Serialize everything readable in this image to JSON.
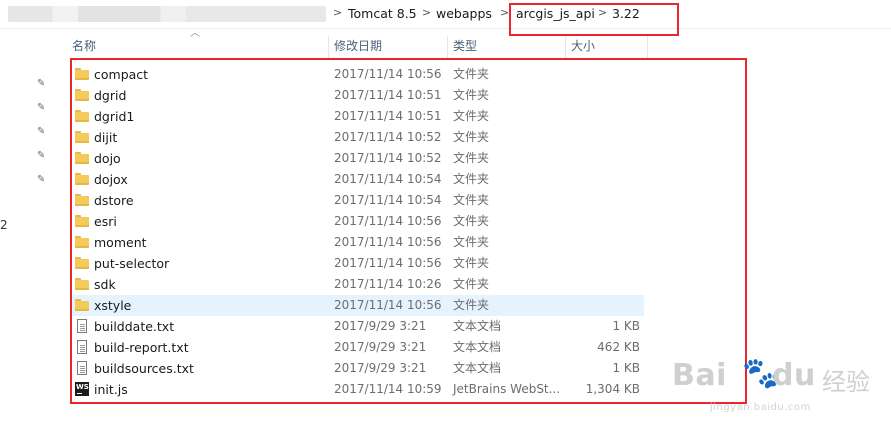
{
  "breadcrumb": {
    "items": [
      "Tomcat 8.5",
      "webapps",
      "arcgis_js_api",
      "3.22"
    ],
    "separator": ">"
  },
  "columns": {
    "name": "名称",
    "modified": "修改日期",
    "type": "类型",
    "size": "大小"
  },
  "side_number": "2",
  "files": [
    {
      "name": "compact",
      "modified": "2017/11/14 10:56",
      "type": "文件夹",
      "size": "",
      "icon": "folder-icon"
    },
    {
      "name": "dgrid",
      "modified": "2017/11/14 10:51",
      "type": "文件夹",
      "size": "",
      "icon": "folder-icon"
    },
    {
      "name": "dgrid1",
      "modified": "2017/11/14 10:51",
      "type": "文件夹",
      "size": "",
      "icon": "folder-icon"
    },
    {
      "name": "dijit",
      "modified": "2017/11/14 10:52",
      "type": "文件夹",
      "size": "",
      "icon": "folder-icon"
    },
    {
      "name": "dojo",
      "modified": "2017/11/14 10:52",
      "type": "文件夹",
      "size": "",
      "icon": "folder-icon"
    },
    {
      "name": "dojox",
      "modified": "2017/11/14 10:54",
      "type": "文件夹",
      "size": "",
      "icon": "folder-icon"
    },
    {
      "name": "dstore",
      "modified": "2017/11/14 10:54",
      "type": "文件夹",
      "size": "",
      "icon": "folder-icon"
    },
    {
      "name": "esri",
      "modified": "2017/11/14 10:56",
      "type": "文件夹",
      "size": "",
      "icon": "folder-icon"
    },
    {
      "name": "moment",
      "modified": "2017/11/14 10:56",
      "type": "文件夹",
      "size": "",
      "icon": "folder-icon"
    },
    {
      "name": "put-selector",
      "modified": "2017/11/14 10:56",
      "type": "文件夹",
      "size": "",
      "icon": "folder-icon"
    },
    {
      "name": "sdk",
      "modified": "2017/11/14 10:26",
      "type": "文件夹",
      "size": "",
      "icon": "folder-icon"
    },
    {
      "name": "xstyle",
      "modified": "2017/11/14 10:56",
      "type": "文件夹",
      "size": "",
      "icon": "folder-icon",
      "selected": true
    },
    {
      "name": "builddate.txt",
      "modified": "2017/9/29 3:21",
      "type": "文本文档",
      "size": "1 KB",
      "icon": "text-file-icon"
    },
    {
      "name": "build-report.txt",
      "modified": "2017/9/29 3:21",
      "type": "文本文档",
      "size": "462 KB",
      "icon": "text-file-icon"
    },
    {
      "name": "buildsources.txt",
      "modified": "2017/9/29 3:21",
      "type": "文本文档",
      "size": "1 KB",
      "icon": "text-file-icon"
    },
    {
      "name": "init.js",
      "modified": "2017/11/14 10:59",
      "type": "JetBrains WebSt...",
      "size": "1,304 KB",
      "icon": "webstorm-file-icon"
    }
  ],
  "watermark": {
    "brand": "Bai",
    "brand_tail": "du",
    "cn": "经验",
    "url": "jingyan.baidu.com"
  },
  "colors": {
    "highlight_box": "#e8262d",
    "selected_row": "#e5f3ff",
    "folder": "#f5c95a",
    "header_text": "#4c607a"
  }
}
